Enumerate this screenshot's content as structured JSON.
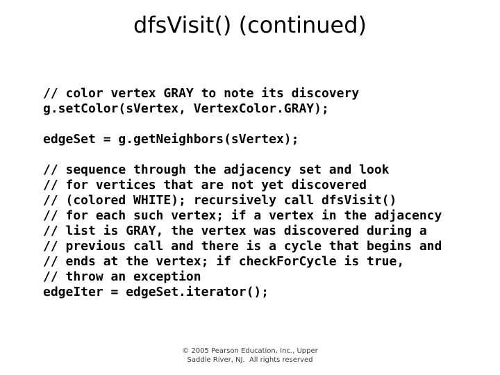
{
  "slide": {
    "title": "dfsVisit() (continued)",
    "text_color": "#000000",
    "background_color": "#ffffff"
  },
  "code": {
    "lines": [
      "// color vertex GRAY to note its discovery",
      "g.setColor(sVertex, VertexColor.GRAY);",
      "",
      "edgeSet = g.getNeighbors(sVertex);",
      "",
      "// sequence through the adjacency set and look",
      "// for vertices that are not yet discovered",
      "// (colored WHITE); recursively call dfsVisit()",
      "// for each such vertex; if a vertex in the adjacency",
      "// list is GRAY, the vertex was discovered during a",
      "// previous call and there is a cycle that begins and",
      "// ends at the vertex; if checkForCycle is true,",
      "// throw an exception",
      "edgeIter = edgeSet.iterator();"
    ]
  },
  "footer": {
    "line1": "© 2005 Pearson Education, Inc., Upper",
    "line2": "Saddle River, NJ.  All rights reserved"
  }
}
